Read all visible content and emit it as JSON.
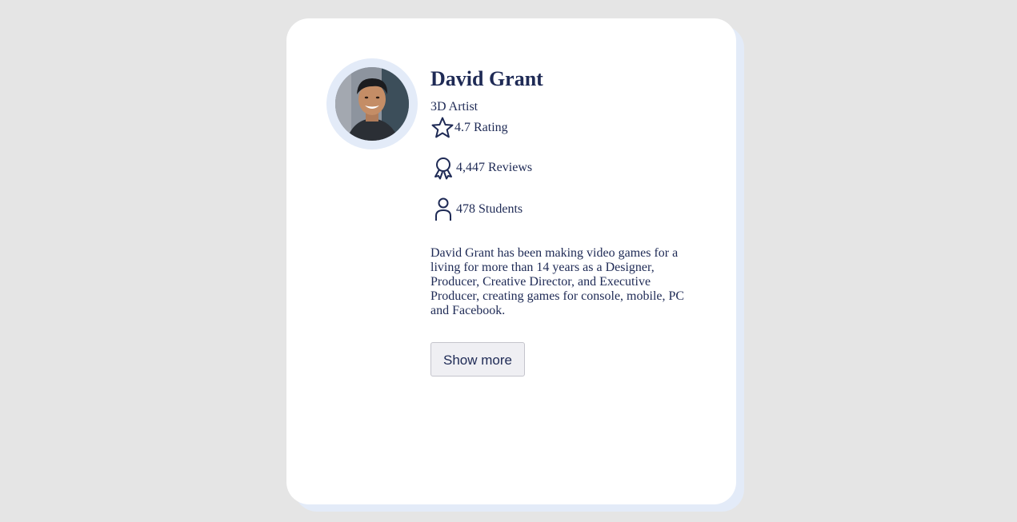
{
  "profile": {
    "name": "David Grant",
    "title": "3D Artist",
    "avatar_icon": "person-photo",
    "stats": {
      "rating": {
        "icon": "star-icon",
        "text": "4.7 Rating"
      },
      "reviews": {
        "icon": "award-ribbon-icon",
        "text": "4,447 Reviews"
      },
      "students": {
        "icon": "user-icon",
        "text": "478 Students"
      }
    },
    "bio": "David Grant has been making video games for a living for more than 14 years as a Designer, Producer, Creative Director, and Executive Producer, creating games for console, mobile, PC and Facebook.",
    "show_more_label": "Show more"
  },
  "colors": {
    "background": "#e5e5e5",
    "card": "#ffffff",
    "card_accent": "#e3ebf8",
    "text": "#1e2a55",
    "button_bg": "#efeff3"
  }
}
